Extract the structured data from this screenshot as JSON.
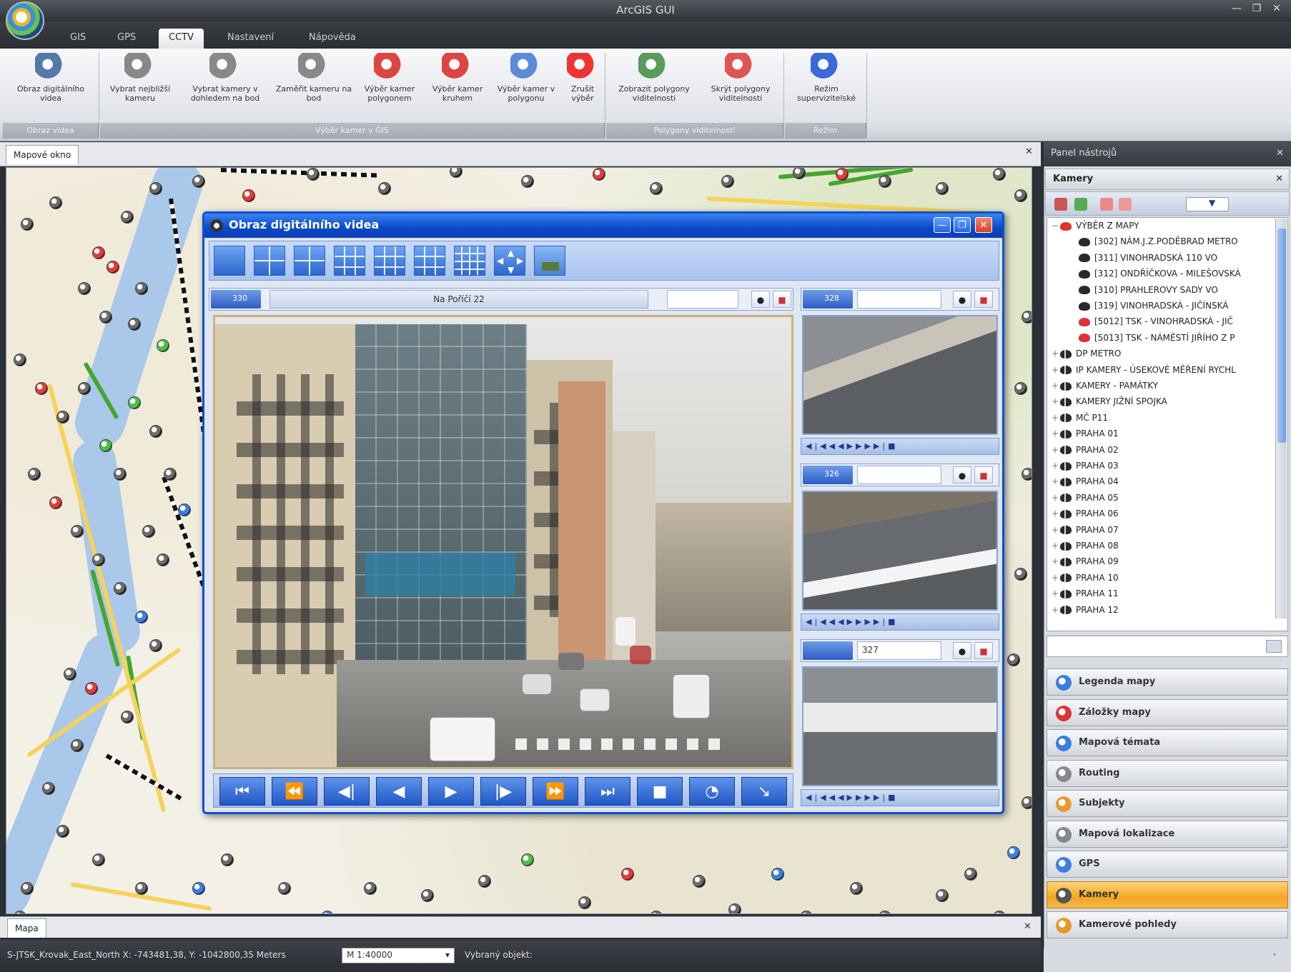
{
  "app": {
    "title": "ArcGIS GUI"
  },
  "menu_tabs": [
    "GIS",
    "GPS",
    "CCTV",
    "Nastavení",
    "Nápověda"
  ],
  "menu_active": "CCTV",
  "ribbon": {
    "buttons": [
      {
        "label": "Obraz digitálního videa",
        "icon": "video-window-icon"
      },
      {
        "label": "Vybrat nejbližší kameru",
        "icon": "camera-nearest-icon"
      },
      {
        "label": "Vybrat kamery v dohledem na bod",
        "icon": "camera-point-icon"
      },
      {
        "label": "Zaměřit kameru na bod",
        "icon": "camera-aim-icon"
      },
      {
        "label": "Výběr kamer polygonem",
        "icon": "camera-polygon-icon"
      },
      {
        "label": "Výběr kamer kruhem",
        "icon": "camera-circle-icon"
      },
      {
        "label": "Výběr kamer v polygonu",
        "icon": "camera-in-polygon-icon"
      },
      {
        "label": "Zrušit výběr",
        "icon": "cancel-selection-icon"
      },
      {
        "label": "Zobrazit polygony viditelnosti",
        "icon": "show-visibility-icon"
      },
      {
        "label": "Skrýt polygony viditelnosti",
        "icon": "hide-visibility-icon"
      },
      {
        "label": "Režim supervizitelské",
        "icon": "supervisor-icon"
      }
    ],
    "groups": [
      "Obraz videa",
      "Výběr kamer v GIS",
      "Polygony viditelnosti",
      "Režim"
    ]
  },
  "doc_tab": "Mapové okno",
  "map_tab": "Mapa",
  "status": {
    "coords": "S-JTSK_Krovak_East_North X: -743481,38, Y: -1042800,35 Meters",
    "scale": "M 1:40000",
    "scale_caret": "▾",
    "action": "Vybraný objekt:"
  },
  "video_window": {
    "title": "Obraz digitálního videa",
    "main_camera": {
      "id": "330",
      "name": "Na Poříčí 22",
      "field": ""
    },
    "small_cameras": [
      {
        "id": "328",
        "field": ""
      },
      {
        "id": "326",
        "field": ""
      },
      {
        "id": "",
        "field": "327"
      }
    ],
    "playback": [
      "⏮",
      "⏪",
      "◀|",
      "◀",
      "▶",
      "|▶",
      "⏩",
      "⏭",
      "■",
      "◔",
      "↘"
    ],
    "small_controls": "◀|◀◀◀▶▶▶▶|■"
  },
  "right_panel": {
    "title": "Panel nástrojů",
    "section": "Kamery",
    "tree": [
      {
        "label": "VÝBĚR Z MAPY",
        "level": 0,
        "toggle": "−",
        "icon": "red"
      },
      {
        "label": "[302] NÁM.J.Z.PODĚBRAD METRO",
        "level": 1,
        "toggle": "",
        "icon": "dark"
      },
      {
        "label": "[311] VINOHRADSKÁ 110 VO",
        "level": 1,
        "toggle": "",
        "icon": "dark"
      },
      {
        "label": "[312] ONDŘÍČKOVA - MILEŠOVSKÁ",
        "level": 1,
        "toggle": "",
        "icon": "dark"
      },
      {
        "label": "[310] PRAHLEROVY SADY VO",
        "level": 1,
        "toggle": "",
        "icon": "dark"
      },
      {
        "label": "[319] VINOHRADSKÁ - JIČÍNSKÁ",
        "level": 1,
        "toggle": "",
        "icon": "dark"
      },
      {
        "label": "[5012] TSK - VINOHRADSKÁ - JIČ",
        "level": 1,
        "toggle": "",
        "icon": "red"
      },
      {
        "label": "[5013] TSK - NÁMĚSTÍ JIŘÍHO Z P",
        "level": 1,
        "toggle": "",
        "icon": "red"
      },
      {
        "label": "DP METRO",
        "level": 0,
        "toggle": "+",
        "icon": "stack"
      },
      {
        "label": "IP KAMERY - ÚSEKOVÉ MĚŘENÍ RYCHL",
        "level": 0,
        "toggle": "+",
        "icon": "stack"
      },
      {
        "label": "KAMERY - PAMÁTKY",
        "level": 0,
        "toggle": "+",
        "icon": "stack"
      },
      {
        "label": "KAMERY JIŽNÍ SPOJKA",
        "level": 0,
        "toggle": "+",
        "icon": "stack"
      },
      {
        "label": "MČ P11",
        "level": 0,
        "toggle": "+",
        "icon": "stack"
      },
      {
        "label": "PRAHA 01",
        "level": 0,
        "toggle": "+",
        "icon": "stack"
      },
      {
        "label": "PRAHA 02",
        "level": 0,
        "toggle": "+",
        "icon": "stack"
      },
      {
        "label": "PRAHA 03",
        "level": 0,
        "toggle": "+",
        "icon": "stack"
      },
      {
        "label": "PRAHA 04",
        "level": 0,
        "toggle": "+",
        "icon": "stack"
      },
      {
        "label": "PRAHA 05",
        "level": 0,
        "toggle": "+",
        "icon": "stack"
      },
      {
        "label": "PRAHA 06",
        "level": 0,
        "toggle": "+",
        "icon": "stack"
      },
      {
        "label": "PRAHA 07",
        "level": 0,
        "toggle": "+",
        "icon": "stack"
      },
      {
        "label": "PRAHA 08",
        "level": 0,
        "toggle": "+",
        "icon": "stack"
      },
      {
        "label": "PRAHA 09",
        "level": 0,
        "toggle": "+",
        "icon": "stack"
      },
      {
        "label": "PRAHA 10",
        "level": 0,
        "toggle": "+",
        "icon": "stack"
      },
      {
        "label": "PRAHA 11",
        "level": 0,
        "toggle": "+",
        "icon": "stack"
      },
      {
        "label": "PRAHA 12",
        "level": 0,
        "toggle": "+",
        "icon": "stack"
      }
    ],
    "nav": [
      {
        "label": "Legenda mapy",
        "icon": "legend-icon",
        "color": "#3b7de2"
      },
      {
        "label": "Záložky mapy",
        "icon": "bookmark-icon",
        "color": "#d33"
      },
      {
        "label": "Mapová témata",
        "icon": "map-themes-icon",
        "color": "#3b7de2"
      },
      {
        "label": "Routing",
        "icon": "routing-icon",
        "color": "#888"
      },
      {
        "label": "Subjekty",
        "icon": "subjects-icon",
        "color": "#e79a2a"
      },
      {
        "label": "Mapová lokalizace",
        "icon": "map-locate-icon",
        "color": "#888"
      },
      {
        "label": "GPS",
        "icon": "gps-icon",
        "color": "#3b7de2"
      },
      {
        "label": "Kamery",
        "icon": "camera-icon",
        "color": "#555",
        "active": true
      },
      {
        "label": "Kamerové pohledy",
        "icon": "camera-views-icon",
        "color": "#e79a2a"
      }
    ]
  },
  "window_controls": [
    "—",
    "❐",
    "✕"
  ],
  "close_glyph": "✕",
  "expand_glyph": "˅",
  "dropdown_glyph": "▼",
  "colors": {
    "accent_blue": "#0f4ed6",
    "active_nav": "#f5a622",
    "camera_red": "#e23b3b"
  }
}
